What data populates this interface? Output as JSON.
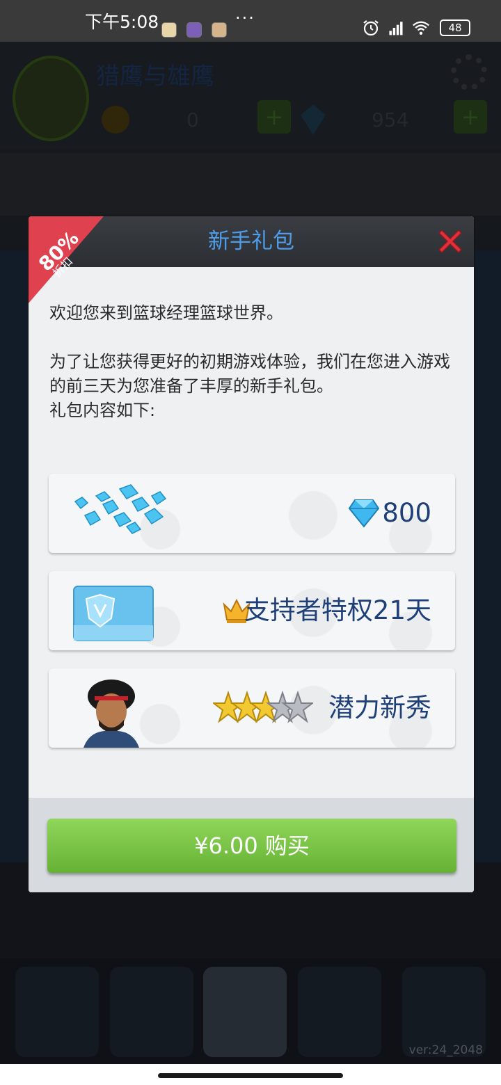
{
  "status_bar": {
    "time": "下午5:08",
    "more": "···",
    "battery": "48",
    "app_icons": [
      "notification-app-icon-1",
      "notification-app-icon-2",
      "notification-app-icon-3"
    ]
  },
  "background": {
    "team_name": "猎鹰与雄鹰",
    "coins": "0",
    "diamonds": "954",
    "version": "ver:24_2048"
  },
  "dialog": {
    "title": "新手礼包",
    "discount": {
      "percent": "80%",
      "label": "折扣"
    },
    "intro_line1": "欢迎您来到篮球经理篮球世界。",
    "intro_line2": "为了让您获得更好的初期游戏体验，我们在您进入游戏的前三天为您准备了丰厚的新手礼包。",
    "intro_line3": "礼包内容如下:",
    "items": [
      {
        "label": "800",
        "icon": "diamond-icon"
      },
      {
        "label": "支持者特权21天",
        "icon": "crown-icon"
      },
      {
        "label": "潜力新秀",
        "icon": "star-rating-icon",
        "stars": 3,
        "max_stars": 5
      }
    ],
    "buy_button": "¥6.00 购买"
  },
  "colors": {
    "title_blue": "#4f9dea",
    "item_text": "#1e3f78",
    "buy_green": "#7cc447",
    "ribbon_red": "#e0414f"
  }
}
